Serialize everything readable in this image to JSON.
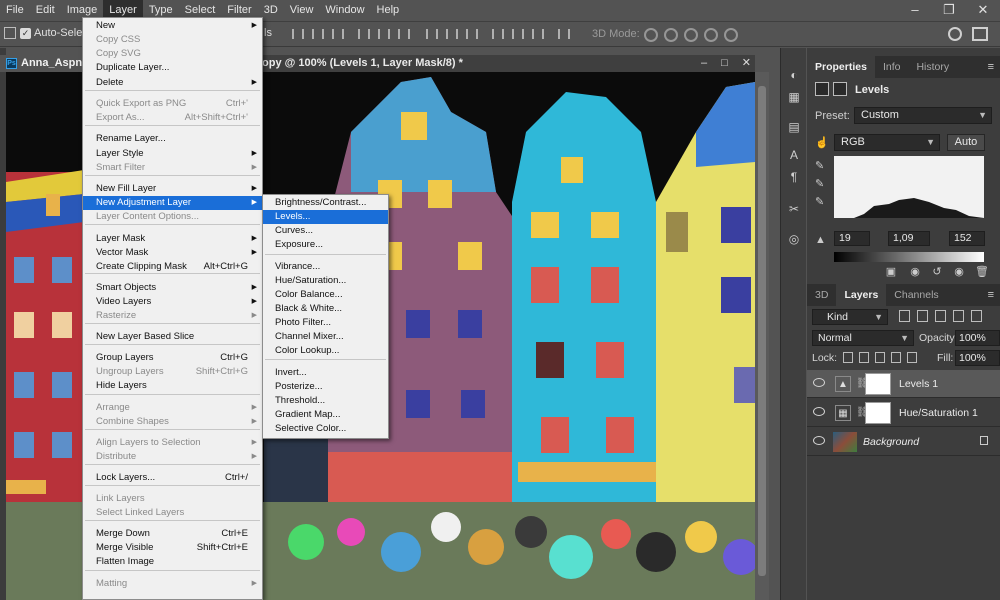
{
  "menubar": {
    "items": [
      "File",
      "Edit",
      "Image",
      "Layer",
      "Type",
      "Select",
      "Filter",
      "3D",
      "View",
      "Window",
      "Help"
    ],
    "active": "Layer"
  },
  "options_bar": {
    "auto_select_label": "Auto-Select",
    "tail_label": "ls",
    "mode_3d": "3D Mode:"
  },
  "document": {
    "tab_label": "Anna_Aspnes",
    "title": "opy @ 100% (Levels 1, Layer Mask/8) *"
  },
  "properties_panel": {
    "tabs": [
      "Properties",
      "Info",
      "History"
    ],
    "active_tab": "Properties",
    "title": "Levels",
    "preset_label": "Preset:",
    "preset_value": "Custom",
    "channel_value": "RGB",
    "auto_label": "Auto",
    "input_levels": {
      "black": "19",
      "gamma": "1,09",
      "white": "152"
    }
  },
  "layers_panel": {
    "tabs": [
      "3D",
      "Layers",
      "Channels"
    ],
    "active_tab": "Layers",
    "kind_label": "Kind",
    "blend_mode": "Normal",
    "opacity_label": "Opacity:",
    "opacity_value": "100%",
    "lock_label": "Lock:",
    "fill_label": "Fill:",
    "fill_value": "100%",
    "layers": [
      {
        "name": "Levels 1",
        "selected": true,
        "italic": false
      },
      {
        "name": "Hue/Saturation 1",
        "selected": false,
        "italic": false
      },
      {
        "name": "Background",
        "selected": false,
        "italic": true
      }
    ]
  },
  "layer_menu": {
    "items": [
      {
        "label": "New",
        "shortcut": "",
        "submenu": true,
        "disabled": false
      },
      {
        "label": "Copy CSS",
        "shortcut": "",
        "submenu": false,
        "disabled": true
      },
      {
        "label": "Copy SVG",
        "shortcut": "",
        "submenu": false,
        "disabled": true
      },
      {
        "label": "Duplicate Layer...",
        "shortcut": "",
        "submenu": false,
        "disabled": false
      },
      {
        "label": "Delete",
        "shortcut": "",
        "submenu": true,
        "disabled": false
      },
      {
        "label": "Quick Export as PNG",
        "shortcut": "Ctrl+'",
        "submenu": false,
        "disabled": true
      },
      {
        "label": "Export As...",
        "shortcut": "Alt+Shift+Ctrl+'",
        "submenu": false,
        "disabled": true
      },
      {
        "label": "Rename Layer...",
        "shortcut": "",
        "submenu": false,
        "disabled": false
      },
      {
        "label": "Layer Style",
        "shortcut": "",
        "submenu": true,
        "disabled": false
      },
      {
        "label": "Smart Filter",
        "shortcut": "",
        "submenu": true,
        "disabled": true
      },
      {
        "label": "New Fill Layer",
        "shortcut": "",
        "submenu": true,
        "disabled": false
      },
      {
        "label": "New Adjustment Layer",
        "shortcut": "",
        "submenu": true,
        "disabled": false,
        "highlighted": true
      },
      {
        "label": "Layer Content Options...",
        "shortcut": "",
        "submenu": false,
        "disabled": true
      },
      {
        "label": "Layer Mask",
        "shortcut": "",
        "submenu": true,
        "disabled": false
      },
      {
        "label": "Vector Mask",
        "shortcut": "",
        "submenu": true,
        "disabled": false
      },
      {
        "label": "Create Clipping Mask",
        "shortcut": "Alt+Ctrl+G",
        "submenu": false,
        "disabled": false
      },
      {
        "label": "Smart Objects",
        "shortcut": "",
        "submenu": true,
        "disabled": false
      },
      {
        "label": "Video Layers",
        "shortcut": "",
        "submenu": true,
        "disabled": false
      },
      {
        "label": "Rasterize",
        "shortcut": "",
        "submenu": true,
        "disabled": true
      },
      {
        "label": "New Layer Based Slice",
        "shortcut": "",
        "submenu": false,
        "disabled": false
      },
      {
        "label": "Group Layers",
        "shortcut": "Ctrl+G",
        "submenu": false,
        "disabled": false
      },
      {
        "label": "Ungroup Layers",
        "shortcut": "Shift+Ctrl+G",
        "submenu": false,
        "disabled": true
      },
      {
        "label": "Hide Layers",
        "shortcut": "",
        "submenu": false,
        "disabled": false
      },
      {
        "label": "Arrange",
        "shortcut": "",
        "submenu": true,
        "disabled": true
      },
      {
        "label": "Combine Shapes",
        "shortcut": "",
        "submenu": true,
        "disabled": true
      },
      {
        "label": "Align Layers to Selection",
        "shortcut": "",
        "submenu": true,
        "disabled": true
      },
      {
        "label": "Distribute",
        "shortcut": "",
        "submenu": true,
        "disabled": true
      },
      {
        "label": "Lock Layers...",
        "shortcut": "Ctrl+/",
        "submenu": false,
        "disabled": false
      },
      {
        "label": "Link Layers",
        "shortcut": "",
        "submenu": false,
        "disabled": true
      },
      {
        "label": "Select Linked Layers",
        "shortcut": "",
        "submenu": false,
        "disabled": true
      },
      {
        "label": "Merge Down",
        "shortcut": "Ctrl+E",
        "submenu": false,
        "disabled": false
      },
      {
        "label": "Merge Visible",
        "shortcut": "Shift+Ctrl+E",
        "submenu": false,
        "disabled": false
      },
      {
        "label": "Flatten Image",
        "shortcut": "",
        "submenu": false,
        "disabled": false
      },
      {
        "label": "Matting",
        "shortcut": "",
        "submenu": true,
        "disabled": true
      }
    ]
  },
  "adjustment_submenu": {
    "items": [
      {
        "label": "Brightness/Contrast...",
        "highlighted": false
      },
      {
        "label": "Levels...",
        "highlighted": true
      },
      {
        "label": "Curves...",
        "highlighted": false
      },
      {
        "label": "Exposure...",
        "highlighted": false
      },
      {
        "label": "Vibrance...",
        "highlighted": false
      },
      {
        "label": "Hue/Saturation...",
        "highlighted": false
      },
      {
        "label": "Color Balance...",
        "highlighted": false
      },
      {
        "label": "Black & White...",
        "highlighted": false
      },
      {
        "label": "Photo Filter...",
        "highlighted": false
      },
      {
        "label": "Channel Mixer...",
        "highlighted": false
      },
      {
        "label": "Color Lookup...",
        "highlighted": false
      },
      {
        "label": "Invert...",
        "highlighted": false
      },
      {
        "label": "Posterize...",
        "highlighted": false
      },
      {
        "label": "Threshold...",
        "highlighted": false
      },
      {
        "label": "Gradient Map...",
        "highlighted": false
      },
      {
        "label": "Selective Color...",
        "highlighted": false
      }
    ]
  },
  "colors": {
    "menu_highlight": "#1a6ed8",
    "panel_bg": "#3d3d3d",
    "app_bg": "#535353"
  }
}
